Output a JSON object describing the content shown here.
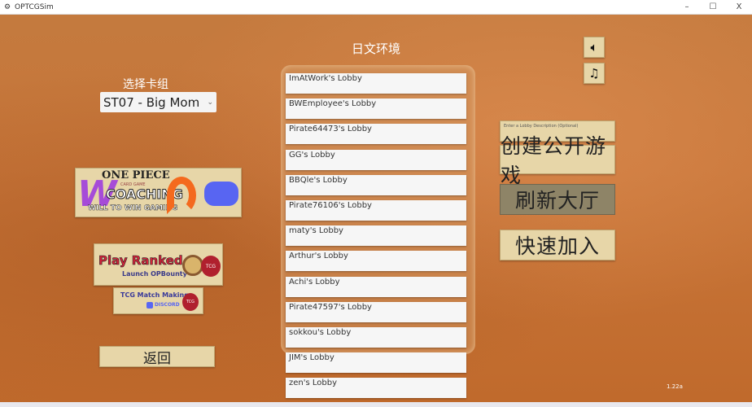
{
  "window": {
    "title": "OPTCGSim",
    "minimize": "–",
    "maximize": "☐",
    "close": "X"
  },
  "header": {
    "language_label": "日文环境"
  },
  "deck": {
    "label": "选择卡组",
    "selected": "ST07 - Big Mom"
  },
  "promos": {
    "coaching": {
      "line1": "ONE PIECE",
      "line2": "CARD GAME",
      "line3": "COACHING",
      "line4": "WILL TO WIN GAMING"
    },
    "ranked": {
      "title": "Play Ranked",
      "subtitle": "Launch OPBounty",
      "badge": "TCG"
    },
    "matchmaking": {
      "title": "TCG Match Making",
      "subtitle": "DISCORD",
      "badge": "TCG"
    }
  },
  "back_label": "返回",
  "lobbies": [
    "ImAtWork's Lobby",
    "BWEmployee's Lobby",
    "Pirate64473's Lobby",
    "GG's Lobby",
    "BBQle's Lobby",
    "Pirate76106's Lobby",
    "maty's Lobby",
    "Arthur's Lobby",
    "Achi's Lobby",
    "Pirate47597's Lobby",
    "sokkou's Lobby",
    "JIM's Lobby",
    "zen's Lobby"
  ],
  "audio": {
    "sound_icon": "speaker-icon",
    "music_icon": "music-note-icon"
  },
  "lobby_form": {
    "description_placeholder": "Enter a Lobby Description (Optional)",
    "create_label": "创建公开游戏",
    "refresh_label": "刷新大厅",
    "quick_join_label": "快速加入"
  },
  "version": "1.22a",
  "colors": {
    "button_tan": "#e7d6a8",
    "button_disabled": "#8e8467",
    "background": "#c06a2c"
  }
}
